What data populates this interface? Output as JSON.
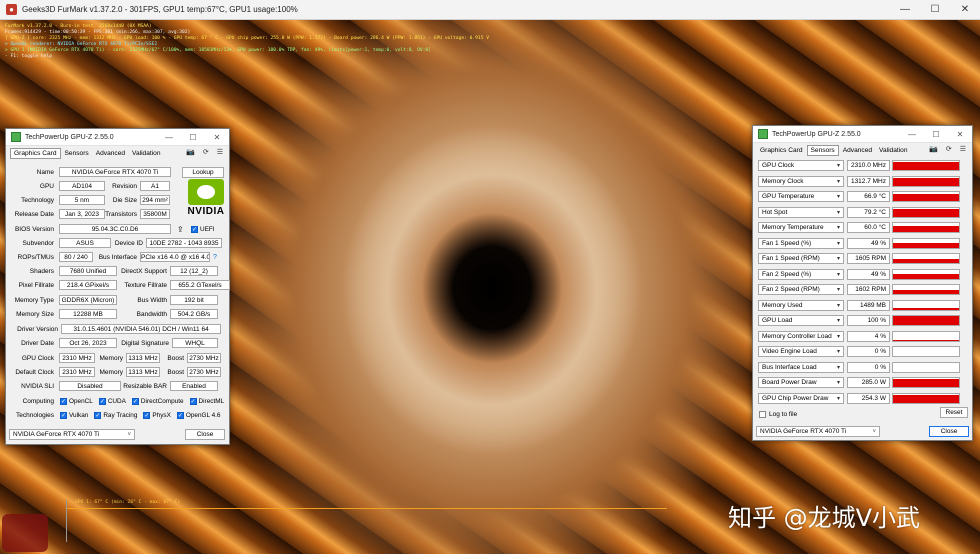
{
  "furmark": {
    "title": "Geeks3D FurMark v1.37.2.0 - 301FPS, GPU1 temp:67°C, GPU1 usage:100%",
    "overlay": [
      {
        "text": "FurMark v1.37.2.0 - Burn-in test, 2560x1440 (0X MSAA)",
        "color": "yellow"
      },
      {
        "text": "Frames:914429 - time:00:50:39 - FPS:301 (min:266, max:307, avg:302)",
        "color": "white"
      },
      {
        "text": "[ GPU-Z ] core: 2325 MHz - mem: 1312 MHz - GPU load: 100 % - GPU temp: 67 ° C - GPU chip power: 255.0 W (PPW: 1.177) - Board power: 286.4 W (PPW: 1.051) - GPU voltage: 0.915 V",
        "color": "yellow"
      },
      {
        "text": "> OpenGL renderer: NVIDIA GeForce RTX 4070 Ti/PCIe/SSE2",
        "color": "cyan"
      },
      {
        "text": "> GPU 1 (NVIDIA GeForce RTX 4070 Ti) - core: 2325MHz/67° C/100%, mem: 10501MHz/13%, GPU power: 100.0% TDP, fan: 49%, limits[power:1, temp:0, volt:0, OV:0]",
        "color": "green"
      },
      {
        "text": "- F1: toggle help",
        "color": "white"
      }
    ],
    "graph_label": "GPU 1: 67° C (min: 26° C - max: 67° C)",
    "logo_text": "FurMark"
  },
  "watermark": "知乎 @龙城V小武",
  "gpuz_left": {
    "title": "TechPowerUp GPU-Z 2.55.0",
    "tabs": [
      "Graphics Card",
      "Sensors",
      "Advanced",
      "Validation"
    ],
    "name_label": "Name",
    "name": "NVIDIA GeForce RTX 4070 Ti",
    "lookup": "Lookup",
    "gpu_label": "GPU",
    "gpu": "AD104",
    "revision_label": "Revision",
    "revision": "A1",
    "tech_label": "Technology",
    "tech": "5 nm",
    "die_label": "Die Size",
    "die": "294 mm²",
    "release_label": "Release Date",
    "release": "Jan 3, 2023",
    "trans_label": "Transistors",
    "trans": "35800M",
    "bios_label": "BIOS Version",
    "bios": "95.04.3C.C0.D6",
    "uefi": "UEFI",
    "subvendor_label": "Subvendor",
    "subvendor": "ASUS",
    "devid_label": "Device ID",
    "devid": "10DE 2782 - 1043 8935",
    "rops_label": "ROPs/TMUs",
    "rops": "80 / 240",
    "bus_label": "Bus Interface",
    "bus": "PCIe x16 4.0 @ x16 4.0",
    "shaders_label": "Shaders",
    "shaders": "7680 Unified",
    "dx_label": "DirectX Support",
    "dx": "12 (12_2)",
    "pixel_label": "Pixel Fillrate",
    "pixel": "218.4 GPixel/s",
    "texture_label": "Texture Fillrate",
    "texture": "655.2 GTexel/s",
    "memtype_label": "Memory Type",
    "memtype": "GDDR6X (Micron)",
    "buswidth_label": "Bus Width",
    "buswidth": "192 bit",
    "memsize_label": "Memory Size",
    "memsize": "12288 MB",
    "bandwidth_label": "Bandwidth",
    "bandwidth": "504.2 GB/s",
    "driver_label": "Driver Version",
    "driver": "31.0.15.4601 (NVIDIA 546.01) DCH / Win11 64",
    "driverdate_label": "Driver Date",
    "driverdate": "Oct 26, 2023",
    "digsig_label": "Digital Signature",
    "digsig": "WHQL",
    "gpuclock_label": "GPU Clock",
    "gpuclock": "2310 MHz",
    "memory_label": "Memory",
    "memclock": "1313 MHz",
    "boost_label": "Boost",
    "boost": "2730 MHz",
    "defclock_label": "Default Clock",
    "defclock": "2310 MHz",
    "defmem": "1313 MHz",
    "defboost": "2730 MHz",
    "sli_label": "NVIDIA SLI",
    "sli": "Disabled",
    "rebar_label": "Resizable BAR",
    "rebar": "Enabled",
    "computing_label": "Computing",
    "computing": [
      "OpenCL",
      "CUDA",
      "DirectCompute",
      "DirectML"
    ],
    "tech2_label": "Technologies",
    "technologies": [
      "Vulkan",
      "Ray Tracing",
      "PhysX",
      "OpenGL 4.6"
    ],
    "select": "NVIDIA GeForce RTX 4070 Ti",
    "close": "Close",
    "nvidia_text": "NVIDIA"
  },
  "gpuz_right": {
    "title": "TechPowerUp GPU-Z 2.55.0",
    "tabs": [
      "Graphics Card",
      "Sensors",
      "Advanced",
      "Validation"
    ],
    "sensors": [
      {
        "name": "GPU Clock",
        "value": "2310.0 MHz",
        "level": 0.85
      },
      {
        "name": "Memory Clock",
        "value": "1312.7 MHz",
        "level": 0.85
      },
      {
        "name": "GPU Temperature",
        "value": "66.9 °C",
        "level": 0.75
      },
      {
        "name": "Hot Spot",
        "value": "79.2 °C",
        "level": 0.8
      },
      {
        "name": "Memory Temperature",
        "value": "60.0 °C",
        "level": 0.7
      },
      {
        "name": "Fan 1 Speed (%)",
        "value": "49 %",
        "level": 0.45
      },
      {
        "name": "Fan 1 Speed (RPM)",
        "value": "1605 RPM",
        "level": 0.45
      },
      {
        "name": "Fan 2 Speed (%)",
        "value": "49 %",
        "level": 0.45
      },
      {
        "name": "Fan 2 Speed (RPM)",
        "value": "1602 RPM",
        "level": 0.45
      },
      {
        "name": "Memory Used",
        "value": "1489 MB",
        "level": 0.12
      },
      {
        "name": "GPU Load",
        "value": "100 %",
        "level": 1.0
      },
      {
        "name": "Memory Controller Load",
        "value": "4 %",
        "level": 0.05
      },
      {
        "name": "Video Engine Load",
        "value": "0 %",
        "level": 0
      },
      {
        "name": "Bus Interface Load",
        "value": "0 %",
        "level": 0
      },
      {
        "name": "Board Power Draw",
        "value": "285.0 W",
        "level": 0.85
      },
      {
        "name": "GPU Chip Power Draw",
        "value": "254.3 W",
        "level": 0.8
      }
    ],
    "log": "Log to file",
    "reset": "Reset",
    "select": "NVIDIA GeForce RTX 4070 Ti",
    "close": "Close"
  }
}
